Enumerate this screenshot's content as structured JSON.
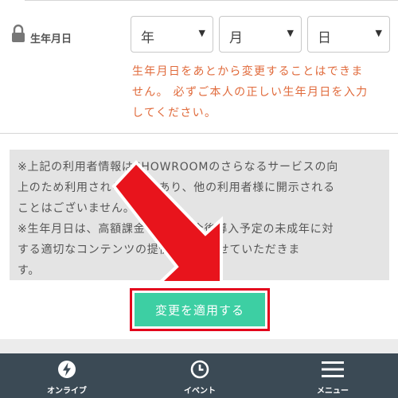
{
  "birthdate": {
    "label": "生年月日",
    "year_placeholder": "年",
    "month_placeholder": "月",
    "day_placeholder": "日",
    "warning_lines": [
      "生年月日をあとから変更することはできま",
      "せん。 必ずご本人の正しい生年月日を入力",
      "してください。"
    ]
  },
  "notice": {
    "lines": [
      "※上記の利用者情報はSHOWROOMのさらなるサービスの向",
      "上のため利用されるものであり、他の利用者様に開示される",
      "ことはございません。",
      "※生年月日は、高額課金の防止、今後導入予定の未成年に対",
      "する適切なコンテンツの提供に利用させていただきま",
      "す。"
    ]
  },
  "apply_button_label": "変更を適用する",
  "bottom_nav": {
    "onlive_label": "オンライブ",
    "event_label": "イベント",
    "menu_label": "メニュー"
  },
  "colors": {
    "warning": "#e06a3b",
    "apply_button": "#3dcfa3",
    "highlight": "#e3001b",
    "nav_background": "#3b4a55"
  },
  "icons": {
    "lock": "lock-icon",
    "caret": "caret-down-icon",
    "onlive": "lightning-icon",
    "event": "clock-icon",
    "menu": "hamburger-icon",
    "annotation": "red-arrow-icon"
  }
}
